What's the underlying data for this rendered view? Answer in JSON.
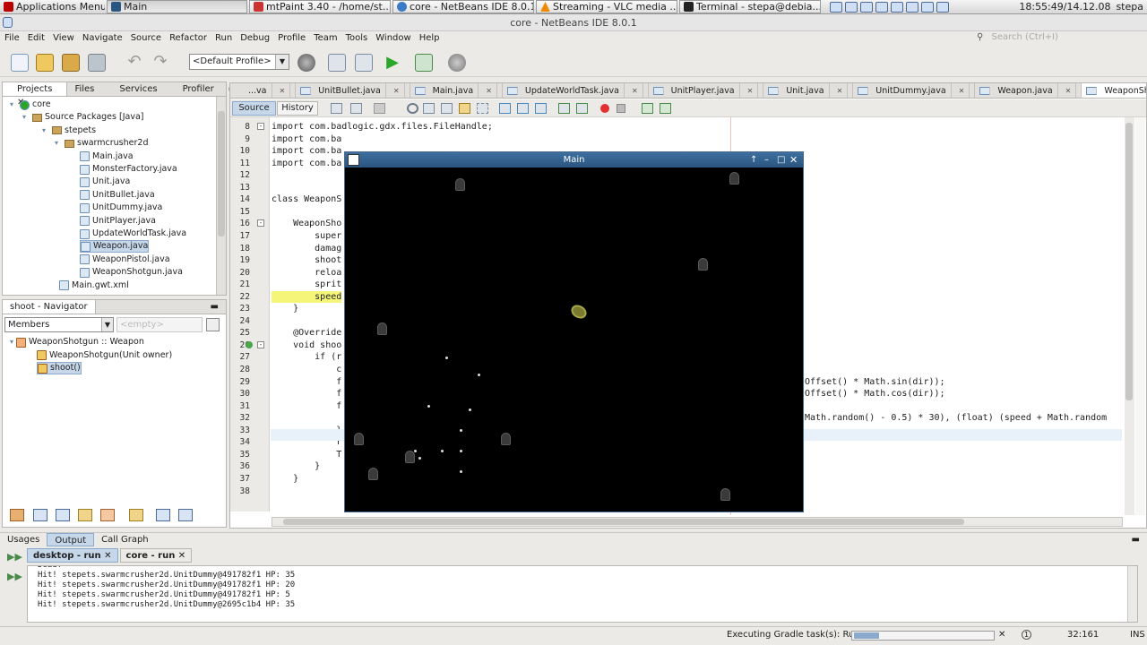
{
  "taskbar": {
    "apps_menu": "Applications Menu",
    "tasks": [
      {
        "label": "Main",
        "icon": "game-window-icon"
      },
      {
        "label": "mtPaint 3.40 - /home/st...",
        "icon": "mtpaint-icon"
      },
      {
        "label": "core - NetBeans IDE 8.0.1",
        "icon": "netbeans-icon"
      },
      {
        "label": "Streaming - VLC media ...",
        "icon": "vlc-icon"
      },
      {
        "label": "Terminal - stepa@debia...",
        "icon": "terminal-icon"
      }
    ],
    "clock": "18:55:49/14.12.08",
    "user": "stepa"
  },
  "window_title": "core - NetBeans IDE 8.0.1",
  "menu": [
    "File",
    "Edit",
    "View",
    "Navigate",
    "Source",
    "Refactor",
    "Run",
    "Debug",
    "Profile",
    "Team",
    "Tools",
    "Window",
    "Help"
  ],
  "search_placeholder": "Search (Ctrl+I)",
  "profile_select": "<Default Profile>",
  "projects_panel": {
    "tabs": [
      "Projects",
      "Files",
      "Services",
      "Profiler"
    ],
    "tree": [
      {
        "label": "core",
        "indent": 0,
        "kind": "project"
      },
      {
        "label": "Source Packages [Java]",
        "indent": 1,
        "kind": "folder"
      },
      {
        "label": "stepets",
        "indent": 2,
        "kind": "package"
      },
      {
        "label": "swarmcrusher2d",
        "indent": 3,
        "kind": "package"
      },
      {
        "label": "Main.java",
        "indent": 4,
        "kind": "file"
      },
      {
        "label": "MonsterFactory.java",
        "indent": 4,
        "kind": "file"
      },
      {
        "label": "Unit.java",
        "indent": 4,
        "kind": "file"
      },
      {
        "label": "UnitBullet.java",
        "indent": 4,
        "kind": "file"
      },
      {
        "label": "UnitDummy.java",
        "indent": 4,
        "kind": "file"
      },
      {
        "label": "UnitPlayer.java",
        "indent": 4,
        "kind": "file"
      },
      {
        "label": "UpdateWorldTask.java",
        "indent": 4,
        "kind": "file"
      },
      {
        "label": "Weapon.java",
        "indent": 4,
        "kind": "file",
        "selected": true
      },
      {
        "label": "WeaponPistol.java",
        "indent": 4,
        "kind": "file"
      },
      {
        "label": "WeaponShotgun.java",
        "indent": 4,
        "kind": "file"
      },
      {
        "label": "Main.gwt.xml",
        "indent": 3,
        "kind": "xml"
      }
    ]
  },
  "navigator": {
    "title": "shoot - Navigator",
    "members_label": "Members",
    "filter_placeholder": "<empty>",
    "items": [
      {
        "label": "WeaponShotgun :: Weapon",
        "indent": 0
      },
      {
        "label": "WeaponShotgun(Unit owner)",
        "indent": 1
      },
      {
        "label": "shoot()",
        "indent": 1,
        "selected": true
      }
    ]
  },
  "editor": {
    "tabs": [
      "...va",
      "UnitBullet.java",
      "Main.java",
      "UpdateWorldTask.java",
      "UnitPlayer.java",
      "Unit.java",
      "UnitDummy.java",
      "Weapon.java",
      "WeaponShotgun.java"
    ],
    "active_tab": "WeaponShotgun.java",
    "source_tab": "Source",
    "history_tab": "History",
    "line_numbers": [
      "8",
      "9",
      "10",
      "11",
      "12",
      "13",
      "14",
      "15",
      "16",
      "17",
      "18",
      "19",
      "20",
      "21",
      "22",
      "23",
      "24",
      "25",
      "26",
      "27",
      "28",
      "29",
      "30",
      "31",
      "32",
      "33",
      "34",
      "35",
      "36",
      "37",
      "38"
    ],
    "code_lines": [
      "import com.badlogic.gdx.files.FileHandle;",
      "import com.ba",
      "import com.ba",
      "import com.ba",
      "",
      "",
      "class WeaponS",
      "",
      "    WeaponSho",
      "        super",
      "        damag",
      "        shoot",
      "        reloa",
      "        sprit",
      "        speed",
      "    }",
      "",
      "    @Override",
      "    void shoo",
      "        if (r",
      "            c",
      "            f",
      "            f",
      "            f",
      "",
      "            }",
      "            r",
      "            T",
      "        }",
      "    }",
      ""
    ],
    "right_code": [
      "Offset() * Math.sin(dir));",
      "Offset() * Math.cos(dir));",
      "Math.random() - 0.5) * 30), (float) (speed + Math.random"
    ]
  },
  "game_window": {
    "title": "Main",
    "enemies": [
      [
        0.25,
        0.05
      ],
      [
        0.85,
        0.03
      ],
      [
        0.78,
        0.28
      ],
      [
        0.08,
        0.47
      ],
      [
        0.03,
        0.79
      ],
      [
        0.35,
        0.79
      ],
      [
        0.14,
        0.84
      ],
      [
        0.06,
        0.89
      ],
      [
        0.83,
        0.95
      ]
    ],
    "bullets": [
      [
        0.22,
        0.55
      ],
      [
        0.29,
        0.6
      ],
      [
        0.18,
        0.69
      ],
      [
        0.27,
        0.7
      ],
      [
        0.25,
        0.76
      ],
      [
        0.15,
        0.82
      ],
      [
        0.21,
        0.82
      ],
      [
        0.25,
        0.82
      ],
      [
        0.16,
        0.84
      ],
      [
        0.25,
        0.88
      ]
    ],
    "player": [
      0.51,
      0.42
    ]
  },
  "bottom": {
    "tabs": [
      "Usages",
      "Output",
      "Call Graph"
    ],
    "output_tabs": [
      "desktop - run",
      "core - run"
    ],
    "lines": [
      "Dead!",
      "Hit! stepets.swarmcrusher2d.UnitDummy@491782f1 HP: 35",
      "Hit! stepets.swarmcrusher2d.UnitDummy@491782f1 HP: 20",
      "Hit! stepets.swarmcrusher2d.UnitDummy@491782f1 HP: 5",
      "Hit! stepets.swarmcrusher2d.UnitDummy@2695c1b4 HP: 35"
    ]
  },
  "status": {
    "task": "Executing Gradle task(s): Run",
    "position": "32:161",
    "mode": "INS"
  }
}
